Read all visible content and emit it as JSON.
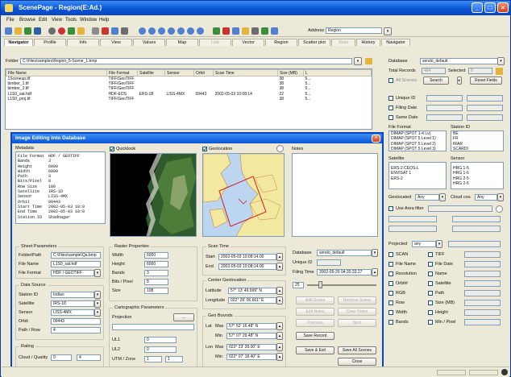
{
  "window": {
    "title": "ScenePage - Region(E:Ad.)"
  },
  "menu": [
    "File",
    "Browse",
    "Edit",
    "View",
    "Tools",
    "Window",
    "Help"
  ],
  "toolbar": {
    "address_label": "Address",
    "address_value": "Region"
  },
  "tabs": [
    "Navigator",
    "Profile",
    "Info",
    "View",
    "Values",
    "Map",
    "Link",
    "Vector",
    "Region",
    "Scatter plot",
    "Stats",
    "History",
    "Navigator"
  ],
  "path": {
    "label": "Folder",
    "value": "C:\\Files\\samples\\Region_5-Scene_1.bmp"
  },
  "file_table": {
    "columns": [
      "File Name",
      "File Format",
      "Satellite",
      "Sensor",
      "Orbit",
      "Scan Time",
      "Size (MB)",
      "L"
    ],
    "rows": [
      [
        "1Sceneup.tif",
        "TIFF/GeoTIFF",
        "",
        "",
        "",
        "",
        "38",
        "5..."
      ],
      [
        "bimber_1.tif",
        "TIFF/GeoTIFF",
        "",
        "",
        "",
        "",
        "38",
        "5..."
      ],
      [
        "bimber_2.tif",
        "TIFF/GeoTIFF",
        "",
        "",
        "",
        "",
        "38",
        "5..."
      ],
      [
        "L1S0_sat.hdf",
        "HDF-EOS",
        "ERS-1B",
        "LISS-4MX",
        "09443",
        "2002-05-03 10:08:14",
        "22",
        "5..."
      ],
      [
        "L1S0_proj.tif",
        "TIFF/GeoTIFF",
        "",
        "",
        "",
        "",
        "38",
        "5..."
      ]
    ]
  },
  "right_panel": {
    "database_label": "Database",
    "database_value": "sendo_default",
    "total_records_label": "Total Records",
    "total_records_value": "464",
    "selected_label": "Selected",
    "selected_value": "0",
    "all_check_label": "All Scenes",
    "search_button": "Search",
    "reset_button": "Reset Fields",
    "criteria": [
      "Unique ID",
      "Filing Date",
      "Same Date"
    ],
    "file_format_label": "File Format",
    "file_formats": [
      "DIMAP (SPOT 1-4 Lv)",
      "DIMAP (SPOT 5 Level 1)",
      "DIMAP (SPOT 5 Level 2)",
      "DIMAP (SPOT 5 Level 3)"
    ],
    "station_label": "Station ID",
    "stations": [
      "BE",
      "FR",
      "IRAR",
      "SCARDI"
    ],
    "satellite_label": "Satellite",
    "satellites": [
      "ERS-2 CEOS-L",
      "ENVISAT 1",
      "ERS-2"
    ],
    "sensor_label": "Sensor",
    "sensors": [
      "HRG 1-5",
      "HRG 1-6",
      "HRG 2-5",
      "HRG 2-6"
    ],
    "geo_label": "Geolocated",
    "geo_value": "Any",
    "cloud_label": "Cloud cov.",
    "cloud_value": "Any",
    "area_label": "Use Area filter",
    "projected_label": "Projected",
    "projected_value": "any",
    "options": [
      "SCAN",
      "TIFF",
      "File Name",
      "File Date",
      "Resolution",
      "Name",
      "Orbit#",
      "Satellite",
      "RGB",
      "Path",
      "Row",
      "Size (MB)",
      "Width",
      "Height",
      "Bands",
      "Min / Pixel"
    ]
  },
  "dialog": {
    "title": "Image Editing Into Database",
    "metadata_label": "Metadata",
    "metadata": [
      [
        "File Format",
        "HDF / GEOTIFF"
      ],
      [
        "Bands",
        "3"
      ],
      [
        "Height",
        "6000"
      ],
      [
        "Width",
        "6000"
      ],
      [
        "Path",
        "3"
      ],
      [
        "Bits/Pixel",
        "8"
      ],
      [
        "Row Size",
        "180"
      ],
      [
        "Satellite",
        "IRS-1D"
      ],
      [
        "Sensor",
        "LISS-4MX"
      ],
      [
        "Orbit",
        "09443"
      ],
      [
        "Start Time",
        "2002-05-03 10:0"
      ],
      [
        "End Time",
        "2002-05-03 10:0"
      ],
      [
        "Station ID",
        "Shadnagar"
      ]
    ],
    "quicklook_label": "Quicklook",
    "geolocation_label": "Geolocation",
    "notes_label": "Notes",
    "sheet_group": "Sheet Parameters",
    "sheet_fields": [
      [
        "Folder/Path",
        "C:\\Files\\sample\\Qa.bmp"
      ],
      [
        "File Name",
        "L1S0_sat.hdf"
      ],
      [
        "File Format",
        "HDF / GEOTIFF"
      ]
    ],
    "source_group": "Data Source",
    "source_fields": [
      [
        "Station ID",
        "Indian"
      ],
      [
        "Satellite",
        "IRS-1D"
      ],
      [
        "Sensor",
        "LISS-4MX"
      ],
      [
        "Orbit",
        "09443"
      ],
      [
        "Path / Row",
        "4"
      ]
    ],
    "rating_group": "Rating",
    "rating_fields": [
      [
        "Cloud / Quality",
        "0",
        "4"
      ]
    ],
    "raster_group": "Raster Properties",
    "raster_fields": [
      [
        "Width",
        "6000"
      ],
      [
        "Height",
        "6000"
      ],
      [
        "Bands",
        "3"
      ],
      [
        "Bits / Pixel",
        "8"
      ],
      [
        "Size",
        "108"
      ]
    ],
    "carto_group": "Cartographic Parameters",
    "projection_label": "Projection",
    "carto_fields": [
      [
        "UL1",
        "0"
      ],
      [
        "UL2",
        "0"
      ],
      [
        "UTM / Zone",
        "1"
      ]
    ],
    "scan_group": "Scan Time",
    "scan_start_label": "Start",
    "scan_start": "2002-05-03 10:08:14.00",
    "scan_end_label": "End",
    "scan_end": "2002-05-03 10:08:14.00",
    "center_group": "Center Geolocation",
    "latitude_label": "Latitude",
    "latitude": "57° 13' 49.999\" N",
    "longitude_label": "Longitude",
    "longitude": "022° 26' 06.661\" E",
    "geobounds_group": "Geo Bounds",
    "bounds": [
      [
        "Lat",
        "Max",
        "57° 52' 16.48\" N"
      ],
      [
        "",
        "Min",
        "57° 07' 29.48\" N"
      ],
      [
        "Lon",
        "Max",
        "023° 23' 28.00\" E"
      ],
      [
        "",
        "Min",
        "022° 07' 18.40\" E"
      ]
    ],
    "db_label": "Database",
    "db_value": "sendo_default",
    "unique_label": "Unique ID",
    "filing_label": "Filing Time",
    "filing_value": "2002-05-29 04:35:33.27",
    "slider_label": "25",
    "buttons_right": [
      "Save Record",
      "Save & Exit",
      "Save All Scenes",
      "Close"
    ],
    "disabled_buttons": [
      "Add Scene",
      "Remove Scene",
      "Edit Notes",
      "Clear Notes",
      "Previous",
      "Next"
    ]
  },
  "colors": {
    "titlebar": "#0a55d6",
    "window": "#ece9d8",
    "map_water": "#bcd6f2",
    "map_land": "#f2e8a0"
  }
}
